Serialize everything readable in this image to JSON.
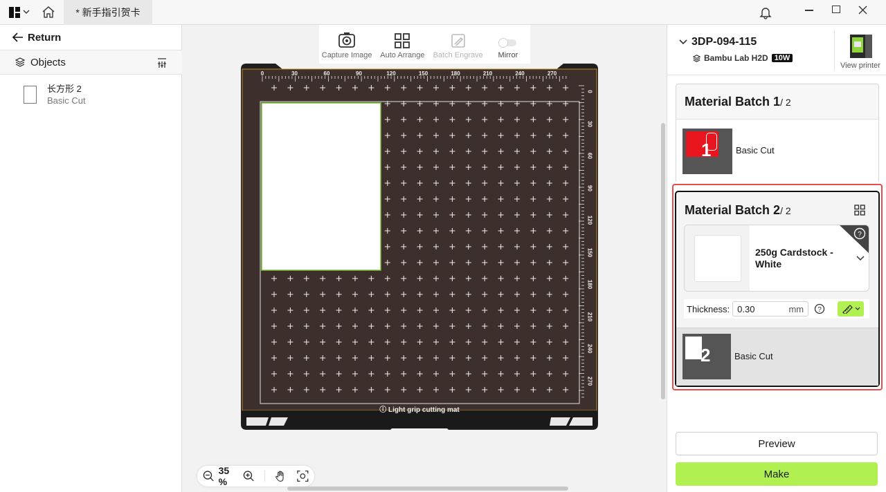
{
  "tab": {
    "title": "* 新手指引贺卡"
  },
  "left": {
    "return_label": "Return",
    "objects_label": "Objects",
    "object": {
      "name": "长方形 2",
      "type": "Basic Cut"
    }
  },
  "toolbar": {
    "capture": "Capture Image",
    "arrange": "Auto Arrange",
    "engrave": "Batch Engrave",
    "mirror": "Mirror"
  },
  "mat": {
    "label": "Light grip cutting mat",
    "top_ticks": [
      "0",
      "30",
      "60",
      "90",
      "120",
      "150",
      "180",
      "210",
      "240",
      "270"
    ],
    "side_ticks": [
      "0",
      "30",
      "60",
      "90",
      "120",
      "150",
      "180",
      "210",
      "240",
      "270"
    ]
  },
  "zoom": {
    "value": "35 %"
  },
  "printer": {
    "name": "3DP-094-115",
    "model": "Bambu Lab H2D",
    "badge": "10W",
    "view": "View printer"
  },
  "batch1": {
    "title": "Material Batch 1",
    "count": "/ 2",
    "num": "1",
    "op": "Basic Cut"
  },
  "batch2": {
    "title": "Material Batch 2",
    "count": "/ 2",
    "num": "2",
    "material_line1": "250g Cardstock -",
    "material_line2": "White",
    "thickness_label": "Thickness:",
    "thickness_value": "0.30",
    "unit": "mm",
    "op": "Basic Cut"
  },
  "actions": {
    "preview": "Preview",
    "make": "Make"
  },
  "colors": {
    "accent": "#b0f050",
    "highlight": "#e84c4c",
    "mat": "#3d302c"
  }
}
